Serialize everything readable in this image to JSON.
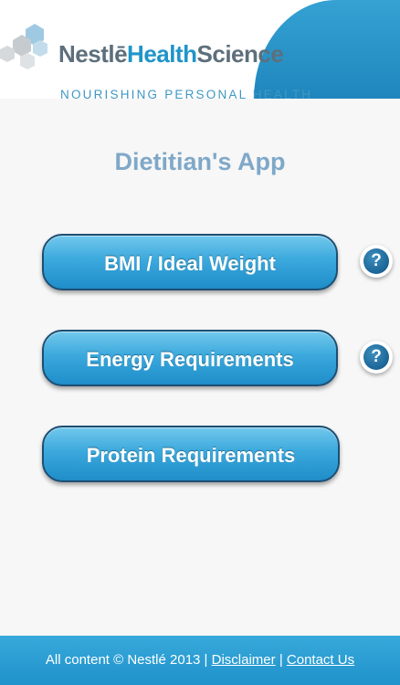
{
  "header": {
    "brand": {
      "part1": "Nestlē",
      "part2": "Health",
      "part3": "Science"
    },
    "tagline": "NOURISHING PERSONAL HEALTH",
    "logo_icon": "nestle-health-science-logo-icon",
    "accent_color": "#2a96ca"
  },
  "main": {
    "title": "Dietitian's App",
    "buttons": [
      {
        "label": "BMI / Ideal Weight",
        "has_help": true
      },
      {
        "label": "Energy Requirements",
        "has_help": true
      },
      {
        "label": "Protein Requirements",
        "has_help": false
      }
    ],
    "help_icon": {
      "glyph": "?",
      "icon": "question-mark-icon"
    }
  },
  "footer": {
    "copyright": "All content © Nestlé 2013 |",
    "separator": "|",
    "disclaimer": "Disclaimer",
    "contact": "Contact Us"
  },
  "colors": {
    "button_blue": "#3ba9dd",
    "button_border": "#1d4e74",
    "title_color": "#7fa8c8",
    "footer_blue": "#2a9dd3"
  }
}
